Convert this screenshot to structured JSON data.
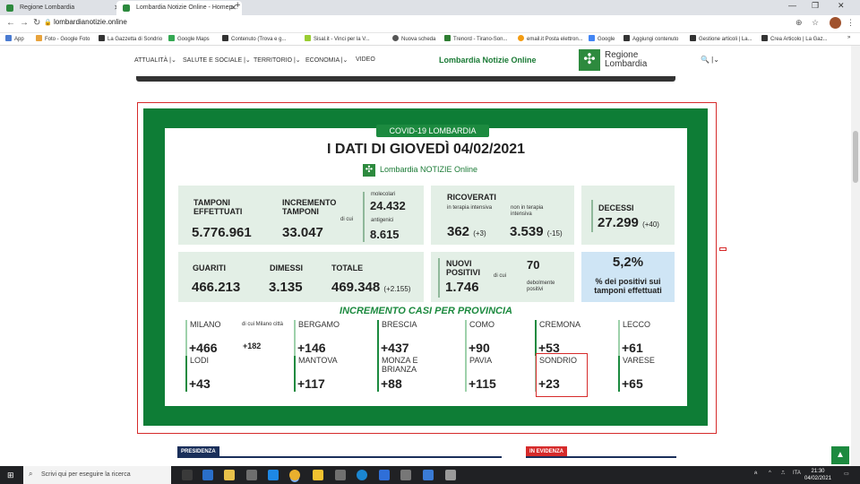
{
  "browser": {
    "tabs": [
      {
        "label": "Regione Lombardia",
        "active": false
      },
      {
        "label": "Lombardia Notizie Online - Homep...",
        "active": true
      }
    ],
    "url": "lombardianotizie.online",
    "bookmarks": [
      {
        "label": "App"
      },
      {
        "label": "Foto - Google Foto"
      },
      {
        "label": "La Gazzetta di Sondrio"
      },
      {
        "label": "Google Maps"
      },
      {
        "label": "Contenuto (Trova e g..."
      },
      {
        "label": "Sisal.it - Vinci per la V..."
      },
      {
        "label": "Nuova scheda"
      },
      {
        "label": "Trenord - Tirano-Son..."
      },
      {
        "label": "email.it Posta elettron..."
      },
      {
        "label": "Google"
      },
      {
        "label": "Aggiungi contenuto"
      },
      {
        "label": "Gestione articoli | La..."
      },
      {
        "label": "Crea Articolo | La Gaz..."
      }
    ]
  },
  "site": {
    "nav": [
      "ATTUALITÀ",
      "SALUTE E SOCIALE",
      "TERRITORIO",
      "ECONOMIA",
      "VIDEO"
    ],
    "brand": "Lombardia Notizie Online",
    "logo_line1": "Regione",
    "logo_line2": "Lombardia"
  },
  "infographic": {
    "tag": "COVID-19 LOMBARDIA",
    "title": "I DATI DI GIOVEDÌ 04/02/2021",
    "subtitle": "Lombardia NOTIZIE Online",
    "tamponi": {
      "label": "TAMPONI EFFETTUATI",
      "value": "5.776.961"
    },
    "incremento": {
      "label": "INCREMENTO TAMPONI",
      "value": "33.047",
      "dicui": "di cui",
      "molecolari_label": "molecolari",
      "molecolari": "24.432",
      "antigenici_label": "antigenici",
      "antigenici": "8.615"
    },
    "ricoverati": {
      "label": "RICOVERATI",
      "ti_label": "in terapia intensiva",
      "ti_value": "362",
      "ti_delta": "(+3)",
      "nti_label": "non in terapia intensiva",
      "nti_value": "3.539",
      "nti_delta": "(-15)"
    },
    "decessi": {
      "label": "DECESSI",
      "value": "27.299",
      "delta": "(+40)"
    },
    "guariti": {
      "label": "GUARITI",
      "value": "466.213"
    },
    "dimessi": {
      "label": "DIMESSI",
      "value": "3.135"
    },
    "totale": {
      "label": "TOTALE",
      "value": "469.348",
      "delta": "(+2.155)"
    },
    "nuovi": {
      "label": "NUOVI POSITIVI",
      "value": "1.746",
      "dicui": "di cui",
      "deb_value": "70",
      "deb_label": "debolmente positivi"
    },
    "perc": {
      "value": "5,2%",
      "label": "% dei positivi sui tamponi effettuati"
    },
    "casi_title": "INCREMENTO CASI PER PROVINCIA",
    "milano_city": {
      "label": "di cui Milano città",
      "value": "+182"
    },
    "provinces": [
      {
        "name": "MILANO",
        "value": "+466"
      },
      {
        "name": "BERGAMO",
        "value": "+146"
      },
      {
        "name": "BRESCIA",
        "value": "+437"
      },
      {
        "name": "COMO",
        "value": "+90"
      },
      {
        "name": "CREMONA",
        "value": "+53"
      },
      {
        "name": "LECCO",
        "value": "+61"
      },
      {
        "name": "LODI",
        "value": "+43"
      },
      {
        "name": "MANTOVA",
        "value": "+117"
      },
      {
        "name": "MONZA E BRIANZA",
        "value": "+88"
      },
      {
        "name": "PAVIA",
        "value": "+115"
      },
      {
        "name": "SONDRIO",
        "value": "+23"
      },
      {
        "name": "VARESE",
        "value": "+65"
      }
    ]
  },
  "sections": {
    "left": "PRESIDENZA",
    "right": "IN EVIDENZA"
  },
  "taskbar": {
    "search_placeholder": "Scrivi qui per eseguire la ricerca",
    "lang": "ITA",
    "time": "21:30",
    "date": "04/02/2021"
  },
  "colors": {
    "green": "#0e7d36",
    "accent": "#1c8a3f",
    "red": "#d62b2b",
    "navy": "#1a2f5a"
  }
}
